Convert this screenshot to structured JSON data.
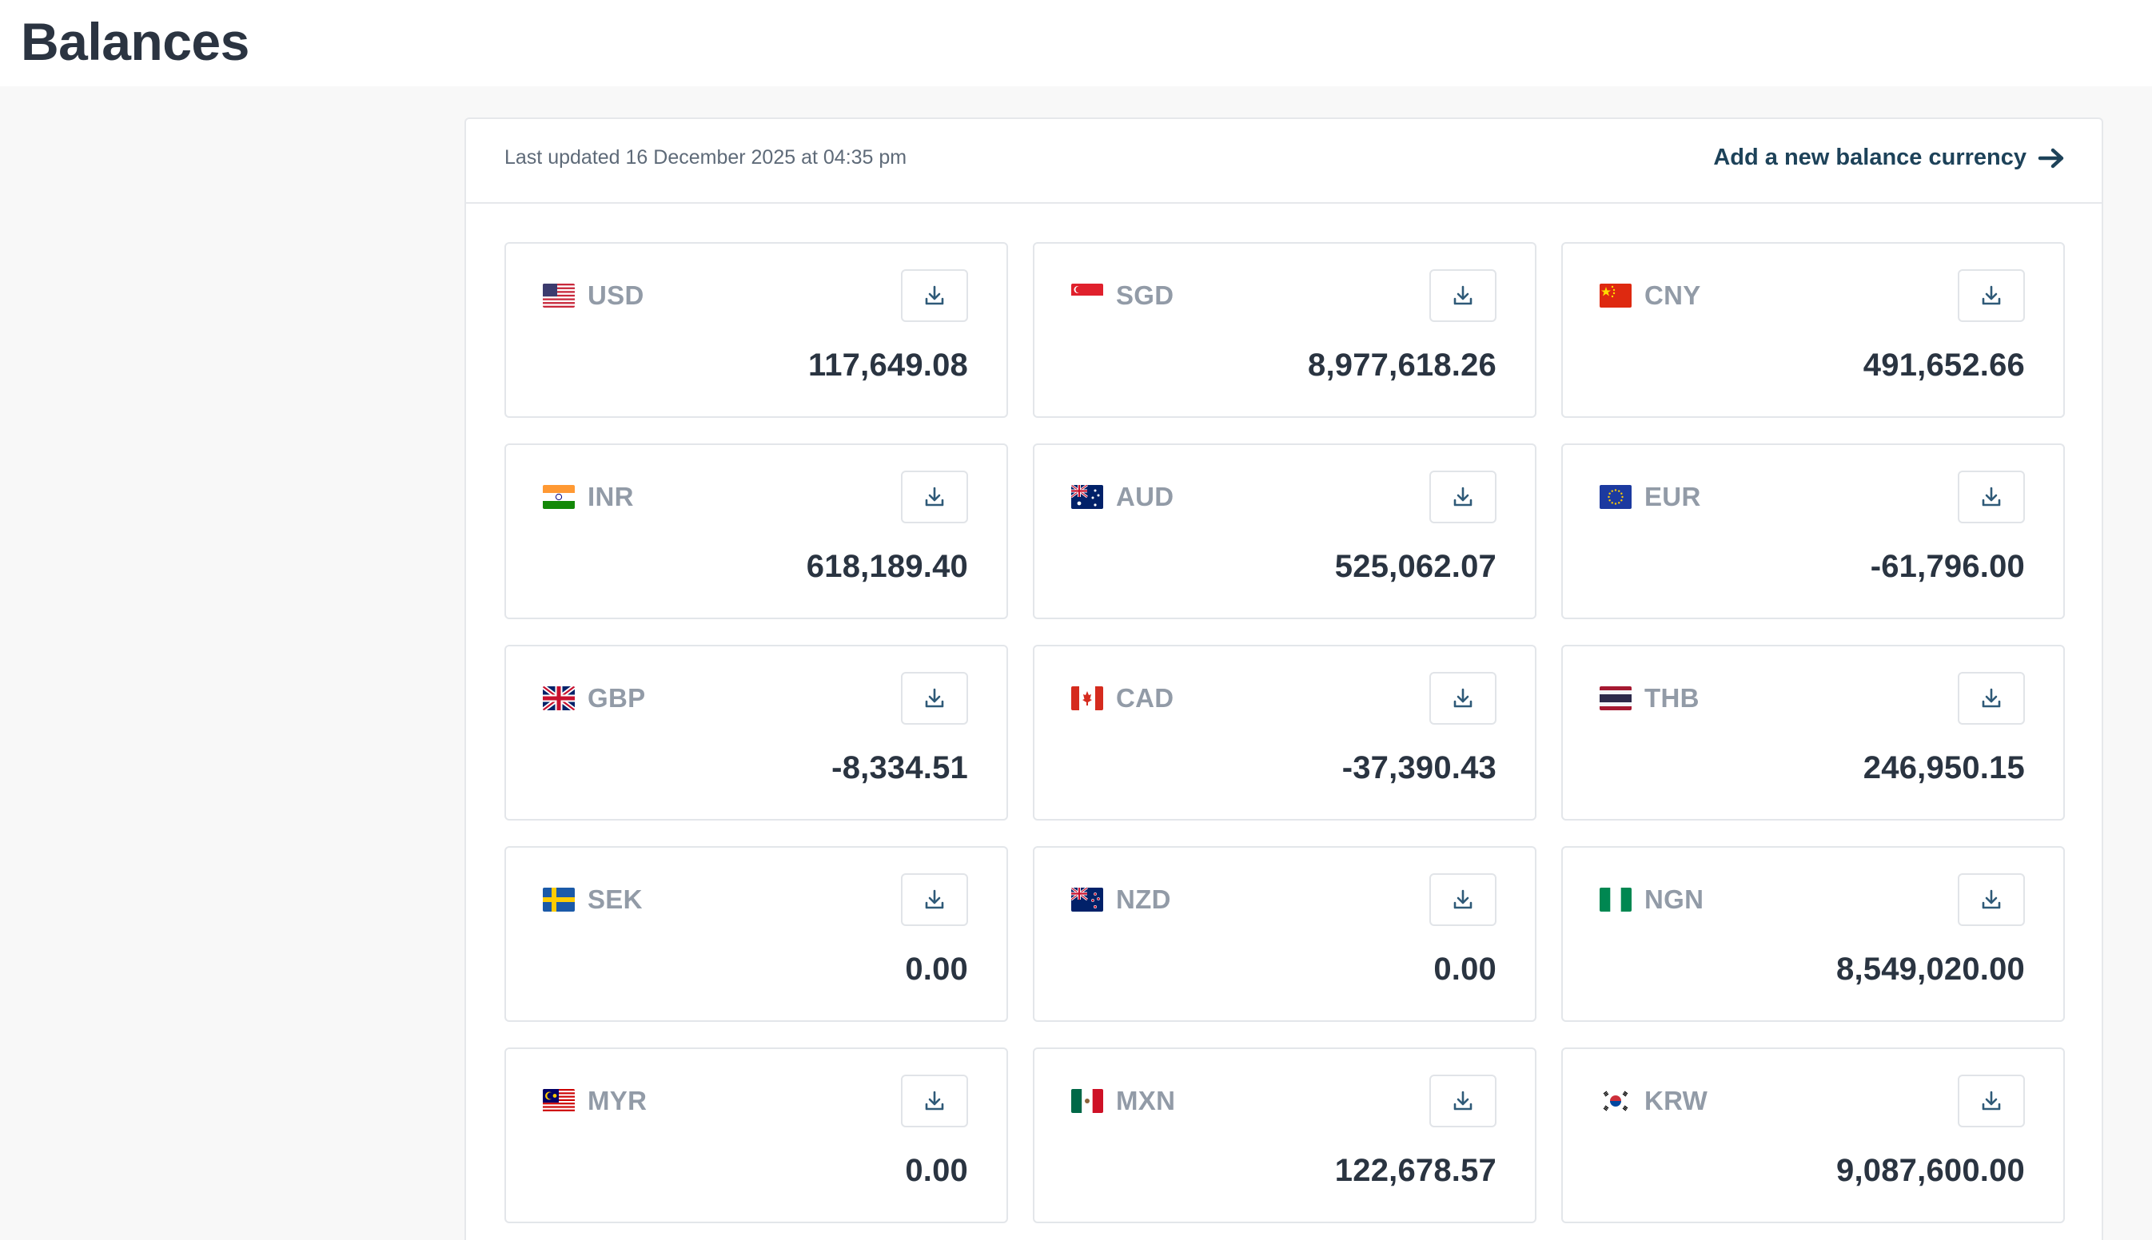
{
  "page": {
    "title": "Balances"
  },
  "panel": {
    "last_updated": "Last updated 16 December 2025 at 04:35 pm",
    "add_link": "Add a new balance currency",
    "add_link_icon": "arrow-right-icon"
  },
  "colors": {
    "title": "#2b3441",
    "link": "#1d4259",
    "currency_code": "#929ba7",
    "amount": "#2a3441",
    "download_icon": "#2f5a78",
    "card_border": "#e3e6ea",
    "background": "#f8f8f8"
  },
  "balances": [
    {
      "code": "USD",
      "amount": "117,649.08",
      "flag": "us-flag-icon"
    },
    {
      "code": "SGD",
      "amount": "8,977,618.26",
      "flag": "sg-flag-icon"
    },
    {
      "code": "CNY",
      "amount": "491,652.66",
      "flag": "cn-flag-icon"
    },
    {
      "code": "INR",
      "amount": "618,189.40",
      "flag": "in-flag-icon"
    },
    {
      "code": "AUD",
      "amount": "525,062.07",
      "flag": "au-flag-icon"
    },
    {
      "code": "EUR",
      "amount": "-61,796.00",
      "flag": "eu-flag-icon"
    },
    {
      "code": "GBP",
      "amount": "-8,334.51",
      "flag": "gb-flag-icon"
    },
    {
      "code": "CAD",
      "amount": "-37,390.43",
      "flag": "ca-flag-icon"
    },
    {
      "code": "THB",
      "amount": "246,950.15",
      "flag": "th-flag-icon"
    },
    {
      "code": "SEK",
      "amount": "0.00",
      "flag": "se-flag-icon"
    },
    {
      "code": "NZD",
      "amount": "0.00",
      "flag": "nz-flag-icon"
    },
    {
      "code": "NGN",
      "amount": "8,549,020.00",
      "flag": "ng-flag-icon"
    },
    {
      "code": "MYR",
      "amount": "0.00",
      "flag": "my-flag-icon"
    },
    {
      "code": "MXN",
      "amount": "122,678.57",
      "flag": "mx-flag-icon"
    },
    {
      "code": "KRW",
      "amount": "9,087,600.00",
      "flag": "kr-flag-icon"
    }
  ],
  "card_action_icon": "download-icon"
}
